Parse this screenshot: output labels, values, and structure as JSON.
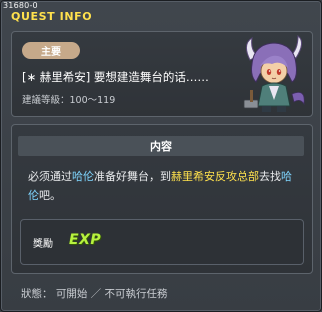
{
  "window": {
    "quest_id": "31680-0",
    "title": "QUEST INFO"
  },
  "summary": {
    "badge": "主要",
    "quest_name": "[∗ 赫里希安] 要想建造舞台的话……",
    "level_label": "建議等級：100～119"
  },
  "content": {
    "header": "内容",
    "text_parts": [
      "必须通过",
      "哈伦",
      "准备好舞台，到",
      "赫里希安反攻总部",
      "去找",
      "哈伦",
      "吧。"
    ]
  },
  "reward": {
    "label": "獎勵",
    "exp_icon": "EXP"
  },
  "status": {
    "text": "狀態： 可開始 ／ 不可執行任務"
  },
  "colors": {
    "title": "#ffe14d",
    "highlight_npc": "#7fd6ff",
    "highlight_place": "#ffe14d",
    "badge": "#c6a98a",
    "exp": "#b7f23f"
  }
}
